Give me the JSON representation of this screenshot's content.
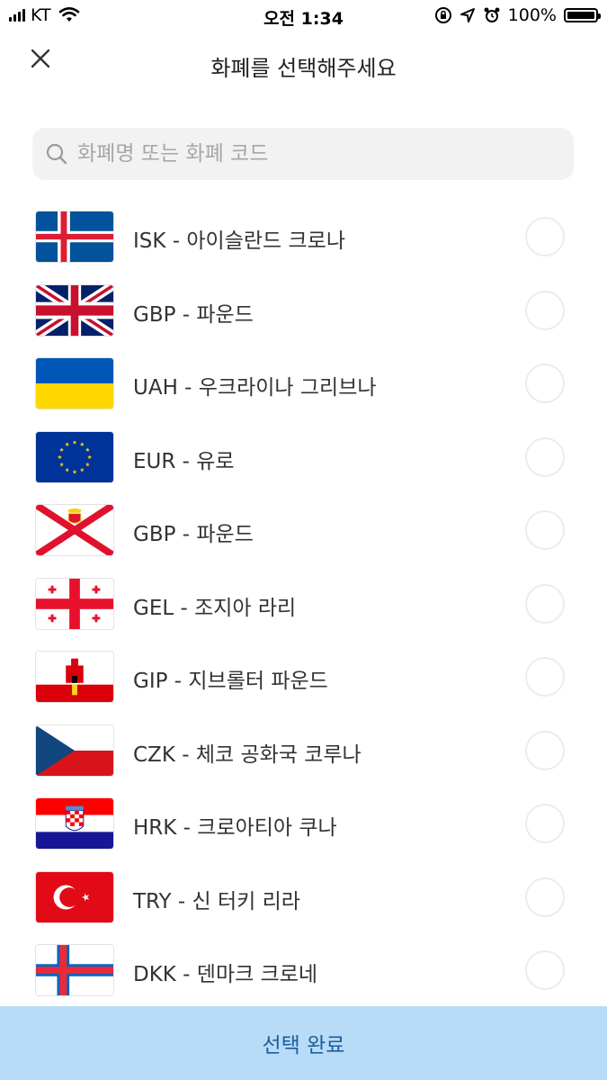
{
  "status_bar": {
    "carrier": "KT",
    "time": "오전 1:34",
    "battery": "100%",
    "battery_level": 1.0
  },
  "header": {
    "title": "화폐를 선택해주세요",
    "close_icon": "close-icon"
  },
  "search": {
    "placeholder": "화폐명 또는 화폐 코드",
    "value": "",
    "icon": "search-icon"
  },
  "currencies": [
    {
      "label": "ISK - 아이슬란드 크로나",
      "flag": "iceland-flag",
      "selected": false
    },
    {
      "label": "GBP - 파운드",
      "flag": "uk-flag",
      "selected": false
    },
    {
      "label": "UAH - 우크라이나 그리브나",
      "flag": "ukraine-flag",
      "selected": false
    },
    {
      "label": "EUR - 유로",
      "flag": "eu-flag",
      "selected": false
    },
    {
      "label": "GBP - 파운드",
      "flag": "jersey-flag",
      "selected": false
    },
    {
      "label": "GEL - 조지아 라리",
      "flag": "georgia-flag",
      "selected": false
    },
    {
      "label": "GIP - 지브롤터 파운드",
      "flag": "gibraltar-flag",
      "selected": false
    },
    {
      "label": "CZK - 체코 공화국 코루나",
      "flag": "czech-flag",
      "selected": false
    },
    {
      "label": "HRK - 크로아티아 쿠나",
      "flag": "croatia-flag",
      "selected": false
    },
    {
      "label": "TRY - 신 터키 리라",
      "flag": "turkey-flag",
      "selected": false
    },
    {
      "label": "DKK - 덴마크 크로네",
      "flag": "faroe-flag",
      "selected": false
    }
  ],
  "footer": {
    "confirm_label": "선택 완료"
  },
  "colors": {
    "confirm_bg": "#b8dcf7",
    "confirm_text": "#1b5e9e",
    "search_bg": "#f2f2f2"
  }
}
